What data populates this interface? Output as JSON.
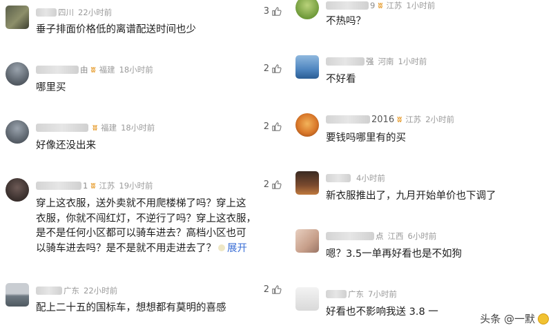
{
  "left": [
    {
      "name_suffix": "",
      "location": "四川",
      "time": "22小时前",
      "likes": "3",
      "text": "垂子排面价格低的离谱配送时间也少"
    },
    {
      "name_suffix": "由",
      "location": "福建",
      "time": "18小时前",
      "likes": "2",
      "text": "哪里买"
    },
    {
      "name_suffix": "",
      "location": "福建",
      "time": "18小时前",
      "likes": "2",
      "text": "好像还没出来"
    },
    {
      "name_suffix": "1",
      "location": "江苏",
      "time": "19小时前",
      "likes": "2",
      "lines": [
        "穿上这衣服，送外卖就不用爬楼梯了吗？穿上这",
        "衣服，你就不闯红灯，不逆行了吗？穿上这衣服，",
        "是不是任何小区都可以骑车进去？高档小区也可",
        "以骑车进去吗？是不是就不用走进去了？"
      ],
      "expand": "展开"
    },
    {
      "name_suffix": "",
      "location": "广东",
      "time": "22小时前",
      "likes": "2",
      "text": "配上二十五的国标车，想想都有莫明的喜感"
    }
  ],
  "right": [
    {
      "name_suffix": "9",
      "location": "江苏",
      "time": "1小时前",
      "text": "不热吗？"
    },
    {
      "name_suffix": "强",
      "location": "河南",
      "time": "1小时前",
      "text": "不好看"
    },
    {
      "name_suffix": "2016",
      "location": "江苏",
      "time": "2小时前",
      "text": "要钱吗哪里有的买"
    },
    {
      "name_suffix": "",
      "location": "",
      "time": "4小时前",
      "text": "新衣服推出了，九月开始单价也下调了"
    },
    {
      "name_suffix": "点",
      "location": "江西",
      "time": "6小时前",
      "text": "嗯？3.5一单再好看也是不如狗"
    },
    {
      "name_suffix": "",
      "location": "广东",
      "time": "7小时前",
      "text": "好看也不影响我送 3.8 一"
    }
  ],
  "watermark": "头条 @一默",
  "colors": {
    "vip": "#e8a23a",
    "link": "#3b6fd6",
    "meta": "#9a9a9a"
  }
}
